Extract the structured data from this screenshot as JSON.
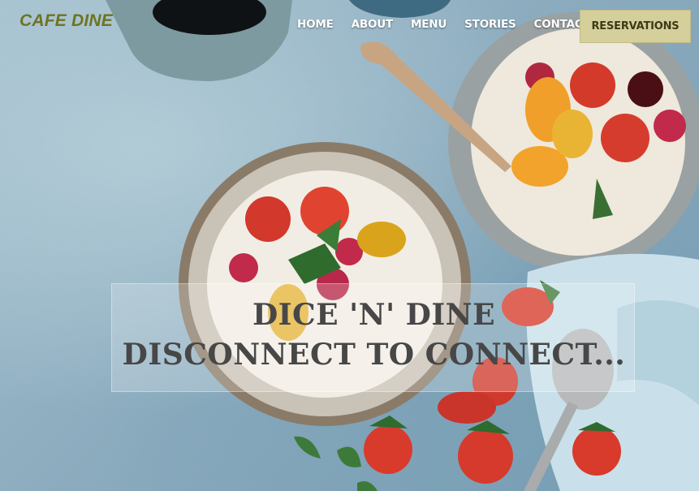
{
  "brand": {
    "name": "CAFE DINE"
  },
  "nav": {
    "items": [
      "HOME",
      "ABOUT",
      "MENU",
      "STORIES",
      "CONTACT"
    ],
    "cta": "RESERVATIONS"
  },
  "hero": {
    "headline": "DICE 'N' DINE",
    "subheadline": "DISCONNECT TO CONNECT..."
  },
  "colors": {
    "brand": "#6f7321",
    "cta_bg": "#d5d09b",
    "banner_text": "#474747"
  }
}
